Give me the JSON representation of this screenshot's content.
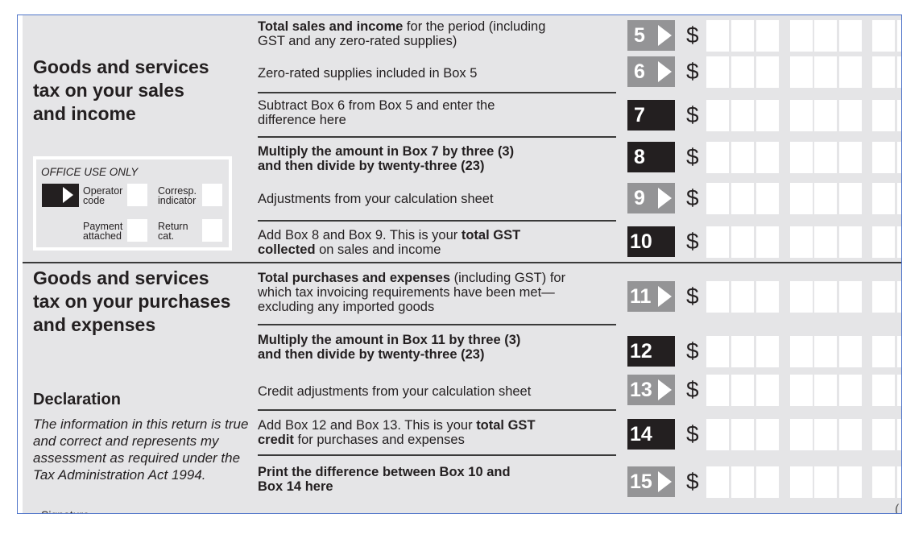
{
  "sections": {
    "sales": {
      "title_lines": [
        "Goods and services",
        "tax on your sales",
        "and income"
      ]
    },
    "purchases": {
      "title_lines": [
        "Goods and services",
        "tax on your purchases",
        "and expenses"
      ]
    }
  },
  "office_use": {
    "title": "OFFICE USE ONLY",
    "operator_code": [
      "Operator",
      "code"
    ],
    "corresp_indicator": [
      "Corresp.",
      "indicator"
    ],
    "payment_attached": [
      "Payment",
      "attached"
    ],
    "return_cat": [
      "Return",
      "cat."
    ]
  },
  "rows": [
    {
      "box": "5",
      "style": "grey",
      "arrow": true,
      "line1_bold": "Total sales and income",
      "line1_rest": " for the period (including",
      "line2": "GST and any zero-rated supplies)"
    },
    {
      "box": "6",
      "style": "grey",
      "arrow": true,
      "line1": "Zero-rated supplies included in Box 5"
    },
    {
      "box": "7",
      "style": "black",
      "arrow": false,
      "line1": "Subtract Box 6 from Box 5 and enter the",
      "line2": "difference here"
    },
    {
      "box": "8",
      "style": "black",
      "arrow": false,
      "line1_bold": "Multiply the amount in Box 7 by three (3)",
      "line2_bold": "and then divide by twenty-three (23)"
    },
    {
      "box": "9",
      "style": "grey",
      "arrow": true,
      "line1": "Adjustments from your calculation sheet"
    },
    {
      "box": "10",
      "style": "black",
      "arrow": false,
      "line1_pre": "Add Box 8 and Box 9. This is your ",
      "line1_bold": "total GST",
      "line2_bold": "collected",
      "line2_rest": " on sales and income"
    },
    {
      "box": "11",
      "style": "grey",
      "arrow": true,
      "line1_bold": "Total purchases and expenses",
      "line1_rest": " (including GST) for",
      "line2": "which tax invoicing requirements have been met—",
      "line3": "excluding any imported goods"
    },
    {
      "box": "12",
      "style": "black",
      "arrow": false,
      "line1_bold": "Multiply the amount in Box 11 by three (3)",
      "line2_bold": "and then divide by twenty-three (23)"
    },
    {
      "box": "13",
      "style": "grey",
      "arrow": true,
      "line1": "Credit adjustments from your calculation sheet"
    },
    {
      "box": "14",
      "style": "black",
      "arrow": false,
      "line1_pre": "Add Box 12 and Box 13. This is your ",
      "line1_bold": "total GST",
      "line2_bold": "credit",
      "line2_rest": " for purchases and expenses"
    },
    {
      "box": "15",
      "style": "grey",
      "arrow": true,
      "line1_bold": "Print the difference between Box 10 and",
      "line2_bold": "Box 14 here"
    }
  ],
  "currency_symbol": "$",
  "declaration": {
    "title": "Declaration",
    "text": "The information in this return is true and correct and represents my assessment as required under the Tax Administration Act 1994.",
    "signature_label": "Signature"
  },
  "truncated_char": "("
}
